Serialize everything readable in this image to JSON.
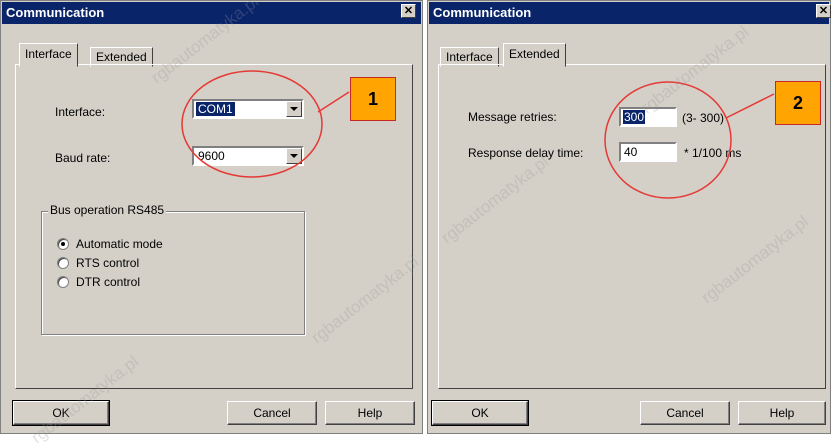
{
  "left_dialog": {
    "title": "Communication",
    "close_glyph": "✕",
    "tabs": [
      "Interface",
      "Extended"
    ],
    "interface_label": "Interface:",
    "interface_value": "COM1",
    "baud_label": "Baud rate:",
    "baud_value": "9600",
    "group_title": "Bus operation  RS485",
    "radio_options": [
      "Automatic mode",
      "RTS control",
      "DTR control"
    ],
    "selected_radio": "Automatic mode",
    "buttons": {
      "ok": "OK",
      "cancel": "Cancel",
      "help": "Help"
    },
    "callout": "1"
  },
  "right_dialog": {
    "title": "Communication",
    "close_glyph": "✕",
    "tabs": [
      "Interface",
      "Extended"
    ],
    "retries_label": "Message retries:",
    "retries_value": "300",
    "retries_range": "(3- 300)",
    "delay_label": "Response delay time:",
    "delay_value": "40",
    "delay_unit": "* 1/100 ms",
    "buttons": {
      "ok": "OK",
      "cancel": "Cancel",
      "help": "Help"
    },
    "callout": "2"
  },
  "colors": {
    "titlebar": "#0a246a",
    "dialog_bg": "#d4d0c8",
    "callout_fill": "#ffa400",
    "annotation_red": "#e53935"
  },
  "watermark": "rgbautomatyka.pl"
}
